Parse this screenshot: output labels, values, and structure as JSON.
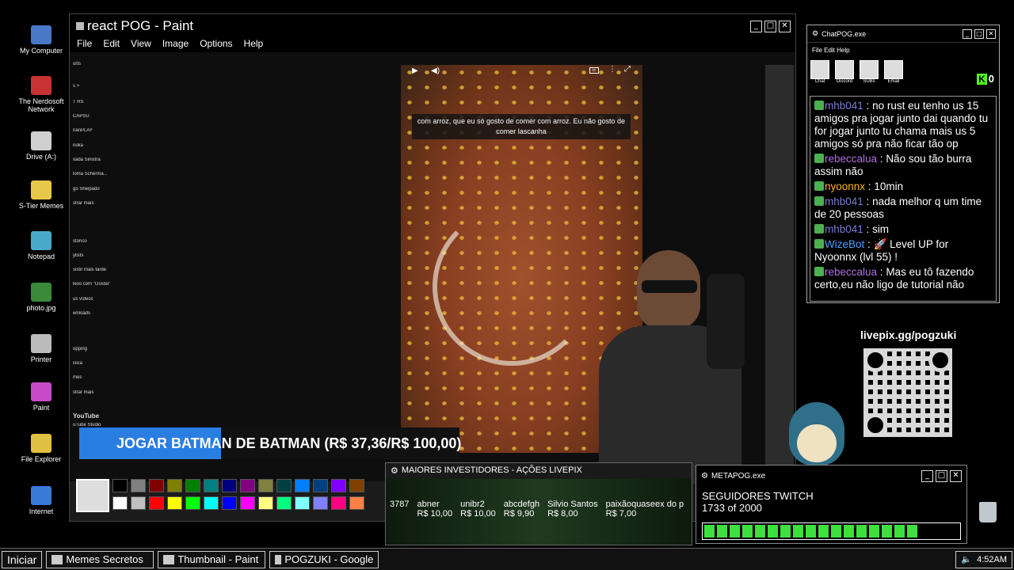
{
  "desktop": {
    "icons": [
      {
        "label": "My Computer",
        "color": "#4a78c8"
      },
      {
        "label": "The Nerdosoft Network",
        "color": "#c83232"
      },
      {
        "label": "Drive (A:)",
        "color": "#cfcfcf"
      },
      {
        "label": "S-Tier Memes",
        "color": "#e8c84a"
      },
      {
        "label": "Notepad",
        "color": "#4aa8c8"
      },
      {
        "label": "photo.jpg",
        "color": "#3a8a3a"
      },
      {
        "label": "Printer",
        "color": "#bbbbbb"
      },
      {
        "label": "Paint",
        "color": "#c84ac8"
      },
      {
        "label": "File Explorer",
        "color": "#e0c040"
      },
      {
        "label": "Internet",
        "color": "#3a7ad8"
      }
    ]
  },
  "paint": {
    "title": "react POG - Paint",
    "menu": [
      "File",
      "Edit",
      "View",
      "Image",
      "Options",
      "Help"
    ],
    "yt_sidebar": [
      "orts",
      "s  >",
      "T RS",
      "CAPSU",
      "nanPLAY",
      "rioka",
      "xada Sinistra",
      "loma Scherma...",
      "go Sheipado",
      "strar mais",
      "stórico",
      "ylists",
      "sistir mais tarde",
      "leos com \"Gostei\"",
      "us vídeos",
      "wnloads",
      "opping",
      "isica",
      "mes",
      "strar mais",
      "YouTube",
      "uTube Studio"
    ],
    "subtitle": "com arroz, que eu só gosto de comer com arroz. Eu não gosto de comer lascanha"
  },
  "palette": {
    "colors": [
      "#000000",
      "#808080",
      "#800000",
      "#808000",
      "#008000",
      "#008080",
      "#000080",
      "#800080",
      "#808040",
      "#004040",
      "#0080ff",
      "#004080",
      "#8000ff",
      "#804000",
      "#ffffff",
      "#c0c0c0",
      "#ff0000",
      "#ffff00",
      "#00ff00",
      "#00ffff",
      "#0000ff",
      "#ff00ff",
      "#ffff80",
      "#00ff80",
      "#80ffff",
      "#8080ff",
      "#ff0080",
      "#ff8040"
    ]
  },
  "banner": {
    "text": "JOGAR BATMAN DE BATMAN (R$ 37,36/R$ 100,00)",
    "progress": 0.3736
  },
  "chat": {
    "title": "ChatPOG.exe",
    "menu": "File Edit Help",
    "tabs": [
      "Chat",
      "Discord",
      "SUBs",
      "Email"
    ],
    "count": "0",
    "messages": [
      {
        "user": "mhb041",
        "color": "#7a7ad8",
        "text": "no rust eu tenho us 15 amigos pra jogar junto dai quando tu for jogar junto tu chama mais us 5 amigos só pra não ficar tão op"
      },
      {
        "user": "rebeccalua",
        "color": "#b070e0",
        "text": "Não sou tão burra assim não"
      },
      {
        "user": "nyoonnx",
        "color": "#ffb020",
        "text": "10min"
      },
      {
        "user": "mhb041",
        "color": "#7a7ad8",
        "text": "nada melhor q um time de 20 pessoas"
      },
      {
        "user": "mhb041",
        "color": "#7a7ad8",
        "text": "sim"
      },
      {
        "user": "WizeBot",
        "color": "#4aa0ff",
        "text": "🚀 Level UP for Nyoonnx (lvl 55) !"
      },
      {
        "user": "rebeccalua",
        "color": "#b070e0",
        "text": "Mas eu tô fazendo certo,eu não ligo de tutorial não"
      }
    ]
  },
  "livepix": {
    "url": "livepix.gg/pogzuki"
  },
  "investors": {
    "title": "MAIORES INVESTIDORES - AÇÕES LIVEPIX",
    "entries": [
      {
        "name": "3787",
        "amount": ""
      },
      {
        "name": "abner",
        "amount": "R$ 10,00"
      },
      {
        "name": "unibr2",
        "amount": "R$ 10,00"
      },
      {
        "name": "abcdefgh",
        "amount": "R$ 9,90"
      },
      {
        "name": "Silvio Santos",
        "amount": "R$ 8,00"
      },
      {
        "name": "paixãoquaseex do p",
        "amount": "R$ 7,00"
      }
    ]
  },
  "metapog": {
    "title": "METAPOG.exe",
    "label": "SEGUIDORES TWITCH",
    "progress_text": "1733 of 2000",
    "progress": 0.8665
  },
  "taskbar": {
    "start": "Iniciar",
    "items": [
      "Memes Secretos",
      "Thumbnail - Paint",
      "POGZUKI - Google"
    ],
    "clock": "4:52AM"
  }
}
